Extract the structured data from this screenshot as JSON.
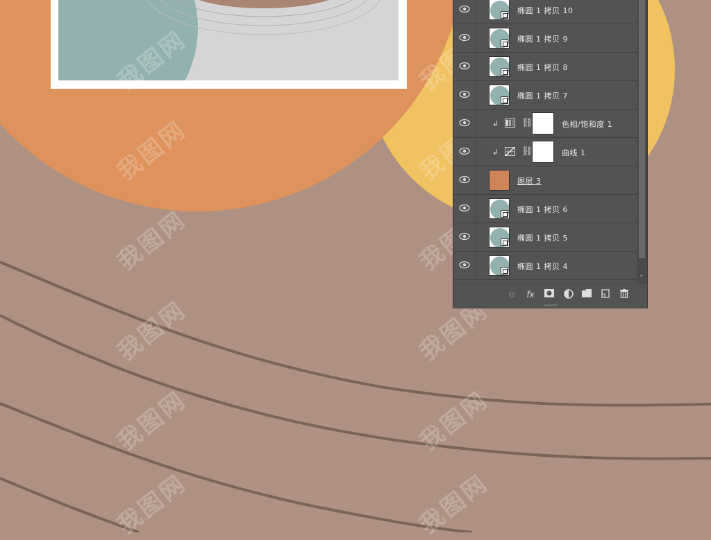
{
  "colors": {
    "background": "#ae9182",
    "orange_circle": "#df935c",
    "yellow_circle": "#f0c260",
    "teal": "#93b2af",
    "card_gray": "#d5d5d5",
    "panel_bg": "#535353",
    "line_stroke": "#7a6459"
  },
  "watermark": "我图网",
  "layers_panel": {
    "layers": [
      {
        "name": "椭圆 1 拷贝 10",
        "type": "shape",
        "visible": true
      },
      {
        "name": "椭圆 1 拷贝 9",
        "type": "shape",
        "visible": true
      },
      {
        "name": "椭圆 1 拷贝 8",
        "type": "shape",
        "visible": true
      },
      {
        "name": "椭圆 1 拷贝 7",
        "type": "shape",
        "visible": true
      },
      {
        "name": "色相/饱和度 1",
        "type": "hue-saturation",
        "visible": true
      },
      {
        "name": "曲线 1",
        "type": "curves",
        "visible": true
      },
      {
        "name": "图层 3",
        "type": "pixel",
        "visible": true
      },
      {
        "name": "椭圆 1 拷贝 6",
        "type": "shape",
        "visible": true
      },
      {
        "name": "椭圆 1 拷贝 5",
        "type": "shape",
        "visible": true
      },
      {
        "name": "椭圆 1 拷贝 4",
        "type": "shape",
        "visible": true
      }
    ],
    "bottom_icons": [
      "link-layers-icon",
      "fx-icon",
      "add-mask-icon",
      "adjustment-layer-icon",
      "new-group-icon",
      "new-layer-icon",
      "delete-layer-icon"
    ],
    "fx_label": "fx"
  }
}
